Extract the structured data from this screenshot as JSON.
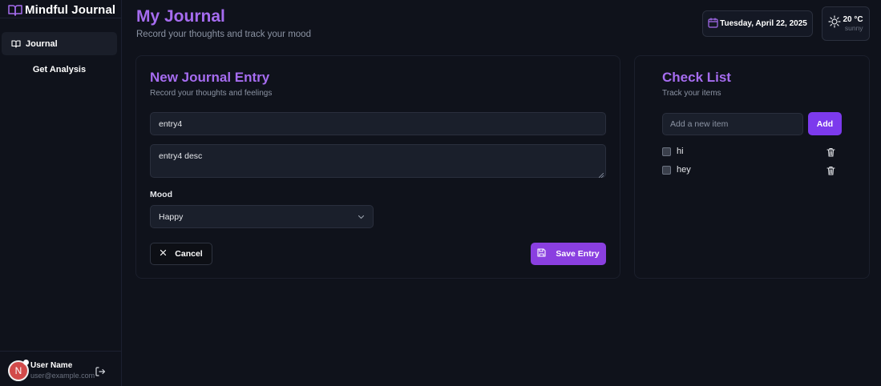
{
  "app": {
    "title": "Mindful Journal"
  },
  "sidebar": {
    "items": [
      {
        "label": "Journal",
        "icon": "book-icon",
        "active": true
      },
      {
        "label": "Get Analysis",
        "active": false
      }
    ],
    "user": {
      "initial": "N",
      "name": "User Name",
      "email": "user@example.com"
    }
  },
  "header": {
    "title": "My Journal",
    "subtitle": "Record your thoughts and track your mood",
    "date": "Tuesday, April 22, 2025",
    "weather": {
      "temp": "20 °C",
      "condition": "sunny"
    }
  },
  "entry": {
    "title": "New Journal Entry",
    "subtitle": "Record your thoughts and feelings",
    "title_value": "entry4",
    "desc_value": "entry4 desc",
    "mood_label": "Mood",
    "mood_value": "Happy",
    "cancel_label": "Cancel",
    "save_label": "Save Entry"
  },
  "checklist": {
    "title": "Check List",
    "subtitle": "Track your items",
    "placeholder": "Add a new item",
    "add_label": "Add",
    "items": [
      {
        "label": "hi",
        "checked": false
      },
      {
        "label": "hey",
        "checked": false
      }
    ]
  },
  "colors": {
    "accent": "#a66cf0",
    "button": "#8a3fe0",
    "background": "#0f121b"
  }
}
